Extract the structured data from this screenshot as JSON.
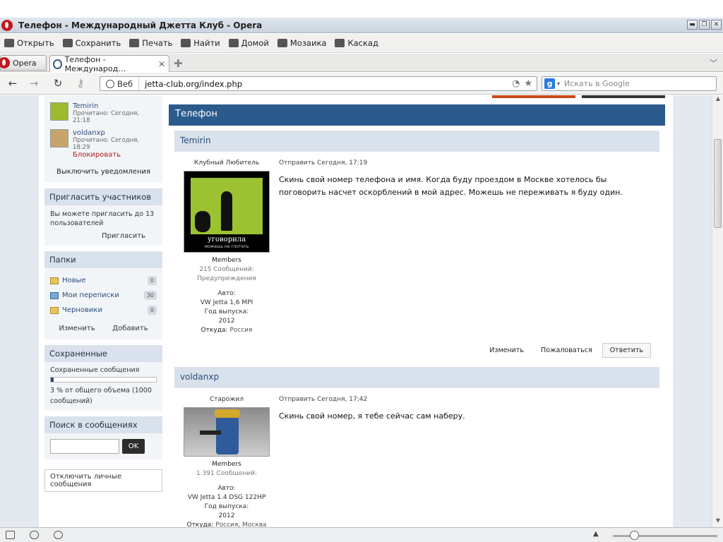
{
  "browser": {
    "window_title": "Телефон - Международный Джетта Клуб - Opera",
    "toolbar": [
      {
        "label": "Открыть",
        "icon": "folder-open-icon"
      },
      {
        "label": "Сохранить",
        "icon": "save-icon"
      },
      {
        "label": "Печать",
        "icon": "print-icon"
      },
      {
        "label": "Найти",
        "icon": "find-icon"
      },
      {
        "label": "Домой",
        "icon": "home-icon"
      },
      {
        "label": "Мозаика",
        "icon": "tile-icon"
      },
      {
        "label": "Каскад",
        "icon": "cascade-icon"
      }
    ],
    "opera_tab": "Opera",
    "active_tab": "Телефон - Международ…",
    "address_mode": "Веб",
    "url": "jetta-club.org/index.php",
    "search_placeholder": "Искать в Google"
  },
  "sidebar": {
    "participants": [
      {
        "name": "Temirin",
        "meta": "Прочитано: Сегодня, 21:18",
        "action": ""
      },
      {
        "name": "voldanxp",
        "meta": "Прочитано: Сегодня, 18:29",
        "action": "Блокировать"
      }
    ],
    "notifications_off": "Выключить уведомления",
    "invite": {
      "title": "Пригласить участников",
      "text": "Вы можете пригласить до 13 пользователей",
      "button": "Пригласить"
    },
    "folders": {
      "title": "Папки",
      "items": [
        {
          "label": "Новые",
          "count": "0"
        },
        {
          "label": "Мои переписки",
          "count": "30"
        },
        {
          "label": "Черновики",
          "count": "0"
        }
      ],
      "edit": "Изменить",
      "add": "Добавить"
    },
    "saved": {
      "title": "Сохраненные",
      "label": "Сохраненные сообщения",
      "usage_percent": 3,
      "text": "3 % от общего объема (1000 сообщений)"
    },
    "search": {
      "title": "Поиск в сообщениях",
      "button": "OK"
    },
    "disable_pm": "Отключить личные сообщения"
  },
  "main": {
    "title": "Телефон",
    "posts": [
      {
        "author": "Temirin",
        "role": "Клубный Любитель",
        "avatar_caption": "уговорила",
        "avatar_subcaption": "можешь не глотать",
        "group": "Members",
        "posts_count": "215 Сообщений:",
        "warnings": "Предупреждения",
        "car_label": "Авто:",
        "car": "VW Jetta 1,6 MPI",
        "year_label": "Год выпуска:",
        "year": "2012",
        "from_label": "Откуда:",
        "from": "Россия",
        "sent": "Отправить  Сегодня, 17:19",
        "text": "Скинь свой номер телефона и имя. Когда буду проездом в Москве хотелось бы поговорить насчет оскорблений в мой адрес. Можешь не переживать я буду один.",
        "actions": [
          "Изменить",
          "Пожаловаться",
          "Ответить"
        ]
      },
      {
        "author": "voldanxp",
        "role": "Старожил",
        "group": "Members",
        "posts_count": "1 391 Сообщений:",
        "car_label": "Авто:",
        "car": "VW Jetta 1.4 DSG 122HP",
        "year_label": "Год выпуска:",
        "year": "2012",
        "from_label": "Откуда:",
        "from": "Россия, Москва",
        "sent": "Отправить  Сегодня, 17:42",
        "text": "Скинь свой номер, я тебе сейчас сам наберу."
      }
    ]
  }
}
